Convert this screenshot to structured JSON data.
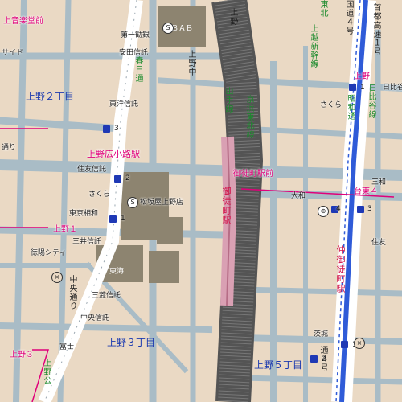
{
  "areas": {
    "ueno2": "上野２丁目",
    "ueno3": "上野３丁目",
    "ueno5": "上野５丁目",
    "ueno_ongakudo": "上音楽堂前",
    "saido": "サイド",
    "dori": "通り"
  },
  "signals": {
    "hirokoji": "上野広小路駅",
    "okachimachi_ekimae": "御徒町駅前",
    "daito4": "台東４",
    "ueno1": "上野１",
    "ueno3": "上野３",
    "ueno_top": "上野"
  },
  "stations": {
    "okachimachi": "御徒町駅",
    "naka_okachimachi": "仲御徒町駅"
  },
  "roads": {
    "chuo_dori": "中央通り",
    "kasuga": "春日通",
    "route4": "国道４号",
    "ueno_kou": "上野公",
    "ueno_chuo": "上野中",
    "shuto": "首都高速１号",
    "showa": "昭和通",
    "tokaido": "通４号"
  },
  "rails": {
    "yamanote": "山手線",
    "keihin": "京浜東北線",
    "jr_top": "上野",
    "shinkansen": "上越新幹線",
    "tohoku": "東北",
    "ginza": "銀座線",
    "hibiya": "日比谷線",
    "hibiya2": "日比谷線",
    "toei": "線"
  },
  "pois": {
    "daiichi_kangyo": "第一勧銀",
    "abab": "ＡＢＡＢ",
    "yasuda": "安田信託",
    "toyo": "東洋信託",
    "sumitomo": "住友信託",
    "sakura1": "さくら",
    "tokyo_sowa": "東京相和",
    "matsuzakaya": "松坂屋上野店",
    "mitsui": "三井信託",
    "tokuyo": "徳陽シティ",
    "tokai": "東海",
    "mitsubishi": "三菱信託",
    "chuo": "中央信託",
    "fuji": "富士",
    "sakura2": "さくら",
    "daiwa": "大和",
    "sanwa": "三和",
    "sumitomo2": "住友",
    "nikko": "日比谷",
    "kogyo": "茨城"
  },
  "exits": {
    "e1": "1",
    "e2": "2",
    "e3": "3",
    "e4": "4",
    "e5": "4",
    "e6": "3",
    "e7": "1",
    "e8": "1",
    "e9": "2",
    "e10": "1"
  },
  "colors": {
    "land": "#ead9c4",
    "street": "#a9bcc6",
    "major_road": "#ffffff",
    "route4_fill": "#ffffff",
    "route4_blue": "#2f5bd8",
    "rail_dark": "#545454",
    "rail_pink": "#d9a0b3",
    "boundary": "#e0007a",
    "building": "#8d8470"
  }
}
